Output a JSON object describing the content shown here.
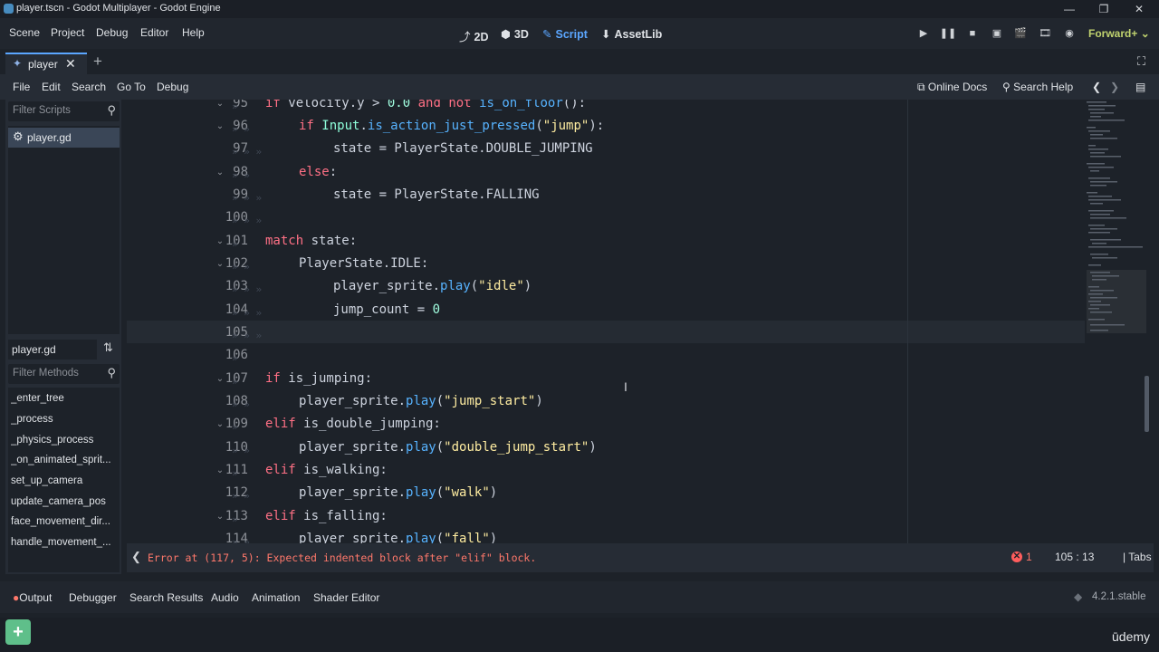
{
  "window": {
    "title": "player.tscn - Godot Multiplayer - Godot Engine",
    "minimize": "—",
    "maximize": "❐",
    "close": "✕"
  },
  "menubar": {
    "items": [
      "Scene",
      "Project",
      "Debug",
      "Editor",
      "Help"
    ],
    "workspaces": [
      {
        "icon": "⤴",
        "label": "2D"
      },
      {
        "icon": "⬢",
        "label": "3D"
      },
      {
        "icon": "✎",
        "label": "Script"
      },
      {
        "icon": "⬇",
        "label": "AssetLib"
      }
    ],
    "renderer": "Forward+"
  },
  "tabs": {
    "open": [
      "player"
    ],
    "add": "+"
  },
  "script_menu": {
    "items": [
      "File",
      "Edit",
      "Search",
      "Go To",
      "Debug"
    ],
    "online_docs": "Online Docs",
    "search_help": "Search Help"
  },
  "left_panel": {
    "filter_scripts_placeholder": "Filter Scripts",
    "scripts": [
      "player.gd"
    ],
    "current_script": "player.gd",
    "filter_methods_placeholder": "Filter Methods",
    "methods": [
      "_enter_tree",
      "_process",
      "_physics_process",
      "_on_animated_sprit...",
      "set_up_camera",
      "update_camera_pos",
      "face_movement_dir...",
      "handle_movement_..."
    ]
  },
  "editor": {
    "line_numbers": [
      "95",
      "96",
      "97",
      "98",
      "99",
      "100",
      "101",
      "102",
      "103",
      "104",
      "105",
      "106",
      "107",
      "108",
      "109",
      "110",
      "111",
      "112",
      "113",
      "114"
    ]
  },
  "status": {
    "error_message": "Error at (117, 5): Expected indented block after \"elif\" block.",
    "error_count": "1",
    "cursor_line": "105",
    "cursor_col": "13",
    "indent_mode": "Tabs"
  },
  "bottom_panel": {
    "tabs": [
      "Output",
      "Debugger",
      "Search Results",
      "Audio",
      "Animation",
      "Shader Editor"
    ],
    "version": "4.2.1.stable"
  },
  "taskbar": {
    "brand": "ūdemy"
  },
  "colors": {
    "accent": "#5ba6ff",
    "keyword": "#ff7085",
    "string": "#ffeda1",
    "function": "#57b3ff",
    "error": "#ff786b"
  }
}
